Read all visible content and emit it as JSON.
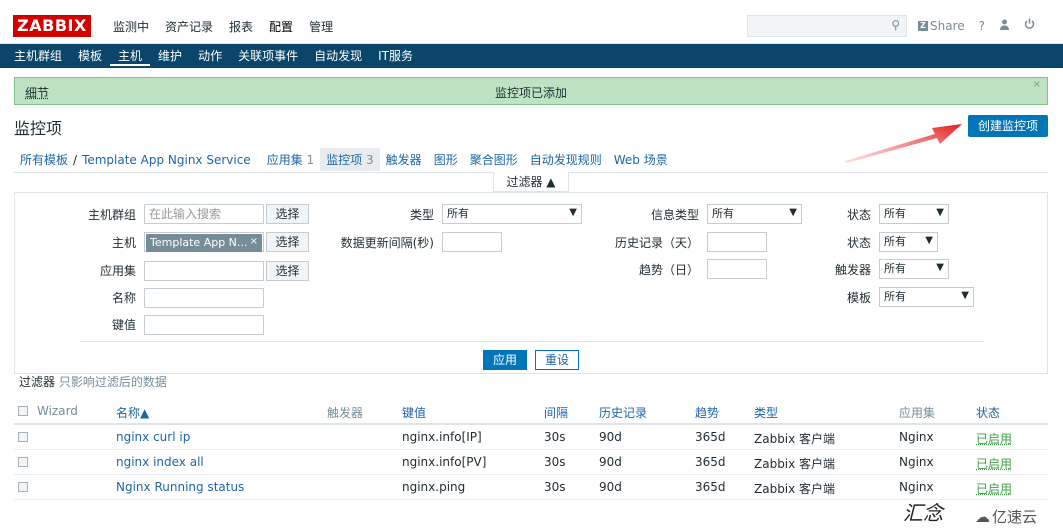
{
  "header": {
    "logo": "ZABBIX",
    "menu": [
      "监测中",
      "资产记录",
      "报表",
      "配置",
      "管理"
    ],
    "share": "Share",
    "help": "?",
    "user_icon": "user-icon",
    "logout_icon": "power-icon"
  },
  "subnav": [
    "主机群组",
    "模板",
    "主机",
    "维护",
    "动作",
    "关联项事件",
    "自动发现",
    "IT服务"
  ],
  "message": {
    "detail": "细节",
    "text": "监控项已添加",
    "close": "×"
  },
  "page": {
    "title": "监控项",
    "create_button": "创建监控项"
  },
  "tabs": {
    "all_templates": "所有模板",
    "sep": "/",
    "template": "Template App Nginx Service",
    "applications": "应用集",
    "applications_count": "1",
    "items": "监控项",
    "items_count": "3",
    "triggers": "触发器",
    "graphs": "图形",
    "screens": "聚合图形",
    "discovery": "自动发现规则",
    "web": "Web 场景"
  },
  "filter": {
    "toggle": "过滤器 ▲",
    "host_group_label": "主机群组",
    "host_group_placeholder": "在此输入搜索",
    "select": "选择",
    "host_label": "主机",
    "host_chip": "Template App N...",
    "host_chip_x": "×",
    "application_label": "应用集",
    "name_label": "名称",
    "key_label": "键值",
    "type_label": "类型",
    "type_value": "所有",
    "interval_label": "数据更新间隔(秒)",
    "info_type_label": "信息类型",
    "info_type_value": "所有",
    "history_label": "历史记录（天）",
    "trends_label": "趋势（日）",
    "status1_label": "状态",
    "status1_value": "所有",
    "status2_label": "状态",
    "status2_value": "所有",
    "triggers_label": "触发器",
    "triggers_value": "所有",
    "template_label": "模板",
    "template_value": "所有",
    "apply": "应用",
    "reset": "重设",
    "note_bold": "过滤器",
    "note": "只影响过滤后的数据"
  },
  "table": {
    "headers": {
      "wizard": "Wizard",
      "name": "名称▲",
      "triggers": "触发器",
      "key": "键值",
      "interval": "间隔",
      "history": "历史记录",
      "trends": "趋势",
      "type": "类型",
      "applications": "应用集",
      "status": "状态"
    },
    "rows": [
      {
        "name": "nginx curl ip",
        "key": "nginx.info[IP]",
        "interval": "30s",
        "history": "90d",
        "trends": "365d",
        "type": "Zabbix 客户端",
        "app": "Nginx",
        "status": "已启用"
      },
      {
        "name": "nginx index all",
        "key": "nginx.info[PV]",
        "interval": "30s",
        "history": "90d",
        "trends": "365d",
        "type": "Zabbix 客户端",
        "app": "Nginx",
        "status": "已启用"
      },
      {
        "name": "Nginx Running status",
        "key": "nginx.ping",
        "interval": "30s",
        "history": "90d",
        "trends": "365d",
        "type": "Zabbix 客户端",
        "app": "Nginx",
        "status": "已启用"
      }
    ]
  },
  "watermark": {
    "text": "汇念",
    "brand": "亿速云"
  },
  "colors": {
    "brand_red": "#d40000",
    "nav_blue": "#0a466a",
    "primary_blue": "#0275b8",
    "success_green": "#bfe3c2",
    "arrow_red": "#e02020"
  }
}
